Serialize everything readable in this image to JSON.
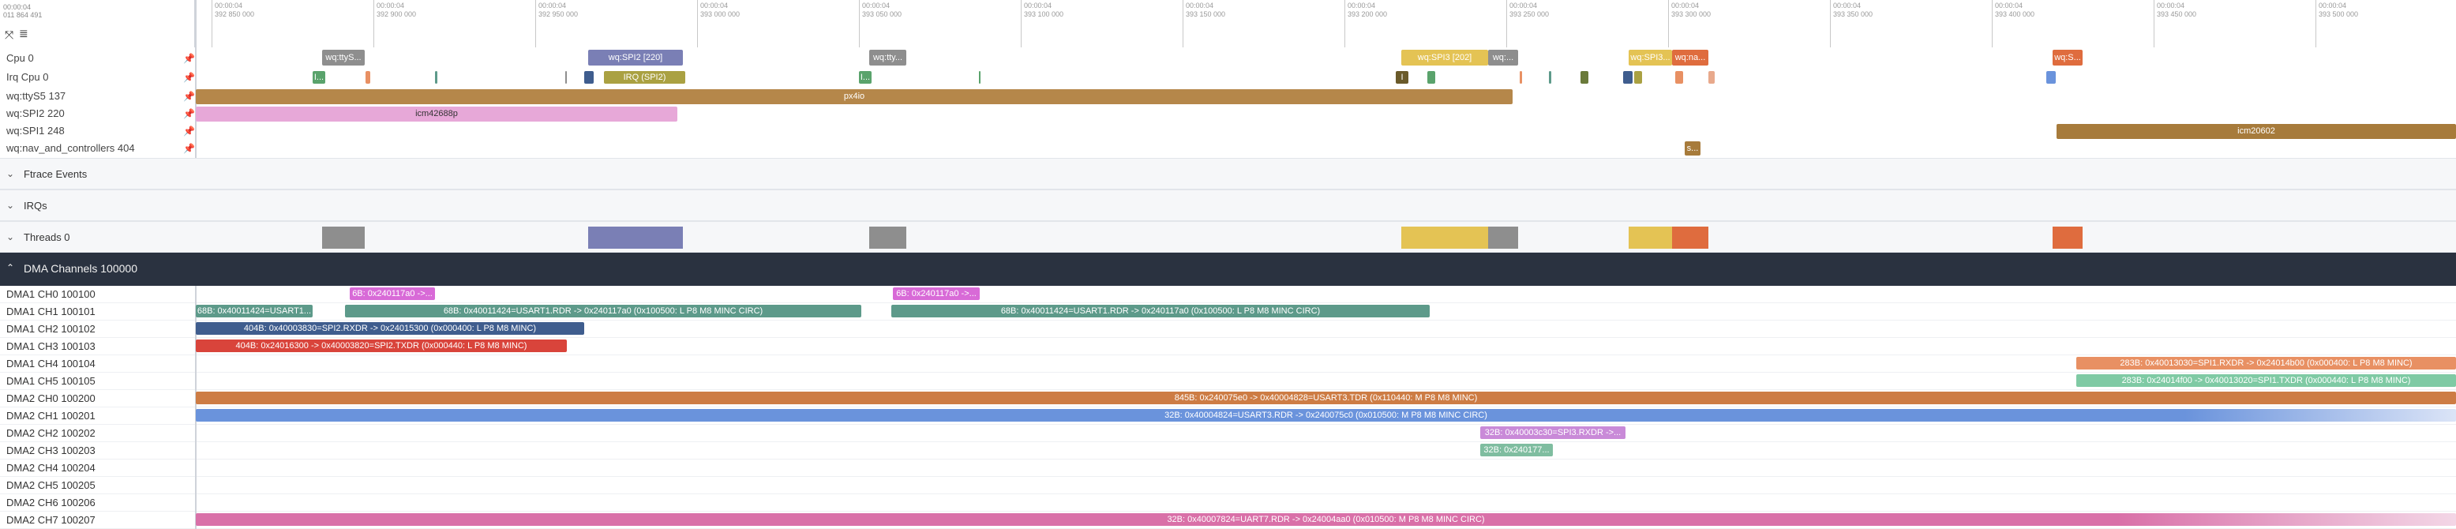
{
  "header": {
    "time_top": "00:00:04",
    "time_bottom": "011 864 491",
    "ticks": [
      {
        "label_a": "00:00:04",
        "label_b": "392 850 000"
      },
      {
        "label_a": "00:00:04",
        "label_b": "392 900 000"
      },
      {
        "label_a": "00:00:04",
        "label_b": "392 950 000"
      },
      {
        "label_a": "00:00:04",
        "label_b": "393 000 000"
      },
      {
        "label_a": "00:00:04",
        "label_b": "393 050 000"
      },
      {
        "label_a": "00:00:04",
        "label_b": "393 100 000"
      },
      {
        "label_a": "00:00:04",
        "label_b": "393 150 000"
      },
      {
        "label_a": "00:00:04",
        "label_b": "393 200 000"
      },
      {
        "label_a": "00:00:04",
        "label_b": "393 250 000"
      },
      {
        "label_a": "00:00:04",
        "label_b": "393 300 000"
      },
      {
        "label_a": "00:00:04",
        "label_b": "393 350 000"
      },
      {
        "label_a": "00:00:04",
        "label_b": "393 400 000"
      },
      {
        "label_a": "00:00:04",
        "label_b": "393 450 000"
      },
      {
        "label_a": "00:00:04",
        "label_b": "393 500 000"
      }
    ]
  },
  "tracks": {
    "cpu0": "Cpu 0",
    "irq_cpu0": "Irq Cpu 0",
    "wq_ttys5": "wq:ttyS5 137",
    "wq_spi2": "wq:SPI2 220",
    "wq_spi1": "wq:SPI1 248",
    "wq_nav": "wq:nav_and_controllers 404"
  },
  "cpu_slices": [
    "wq:ttyS...",
    "wq:SPI2 [220]",
    "wq:tty...",
    "wq:SPI3 [202]",
    "wq:...",
    "wq:SPI3...",
    "wq:na...",
    "wq:S..."
  ],
  "irq_slices": [
    "I...",
    "IRQ (SPI2)",
    "I...",
    "I"
  ],
  "thread_slices": {
    "ttys5": "px4io",
    "spi2": "icm42688p",
    "spi1": "icm20602",
    "nav": "s..."
  },
  "groups": {
    "ftrace": "Ftrace Events",
    "irqs": "IRQs",
    "threads": "Threads 0",
    "dma": "DMA Channels 100000"
  },
  "dma_channels": [
    "DMA1 CH0 100100",
    "DMA1 CH1 100101",
    "DMA1 CH2 100102",
    "DMA1 CH3 100103",
    "DMA1 CH4 100104",
    "DMA1 CH5 100105",
    "DMA2 CH0 100200",
    "DMA2 CH1 100201",
    "DMA2 CH2 100202",
    "DMA2 CH3 100203",
    "DMA2 CH4 100204",
    "DMA2 CH5 100205",
    "DMA2 CH6 100206",
    "DMA2 CH7 100207"
  ],
  "dma_slices": {
    "ch0_a": "6B: 0x240117a0 ->...",
    "ch0_b": "6B: 0x240117a0 ->...",
    "ch1_a": "68B: 0x40011424=USART1...",
    "ch1_b": "68B: 0x40011424=USART1.RDR -> 0x240117a0 (0x100500: L P8 M8 MINC CIRC)",
    "ch1_c": "68B: 0x40011424=USART1.RDR -> 0x240117a0 (0x100500: L P8 M8 MINC CIRC)",
    "ch2": "404B: 0x40003830=SPI2.RXDR -> 0x24015300 (0x000400: L P8 M8 MINC)",
    "ch3": "404B: 0x24016300 -> 0x40003820=SPI2.TXDR (0x000440: L P8 M8 MINC)",
    "ch4": "283B: 0x40013030=SPI1.RXDR -> 0x24014b00 (0x000400: L P8 M8 MINC)",
    "ch5": "283B: 0x24014f00 -> 0x40013020=SPI1.TXDR (0x000440: L P8 M8 MINC)",
    "d2ch0": "845B: 0x240075e0 -> 0x40004828=USART3.TDR (0x110440: M P8 M8 MINC)",
    "d2ch1": "32B: 0x40004824=USART3.RDR -> 0x240075c0 (0x010500: M P8 M8 MINC CIRC)",
    "d2ch2": "32B: 0x40003c30=SPI3.RXDR ->...",
    "d2ch3": "32B: 0x240177...",
    "d2ch7": "32B: 0x40007824=UART7.RDR -> 0x24004aa0 (0x010500: M P8 M8 MINC CIRC)"
  },
  "colors": {
    "grey": "#8e8e8e",
    "slate": "#7a7fb5",
    "gold": "#e4c354",
    "orange": "#df6c3e",
    "brown": "#b5874a",
    "pink": "#e7a8d8",
    "green": "#5aa36c",
    "olive": "#aaa142",
    "teal": "#5d9a8a",
    "navy": "#3f5d8e",
    "red": "#d9443b",
    "magenta": "#d86ad7",
    "salmon": "#e89063",
    "mint": "#7fcaa4",
    "burnt": "#cd7c44",
    "blue": "#6a93dc",
    "violet": "#c98ad8",
    "seafoam": "#7fbda0",
    "rose": "#d970a8"
  }
}
